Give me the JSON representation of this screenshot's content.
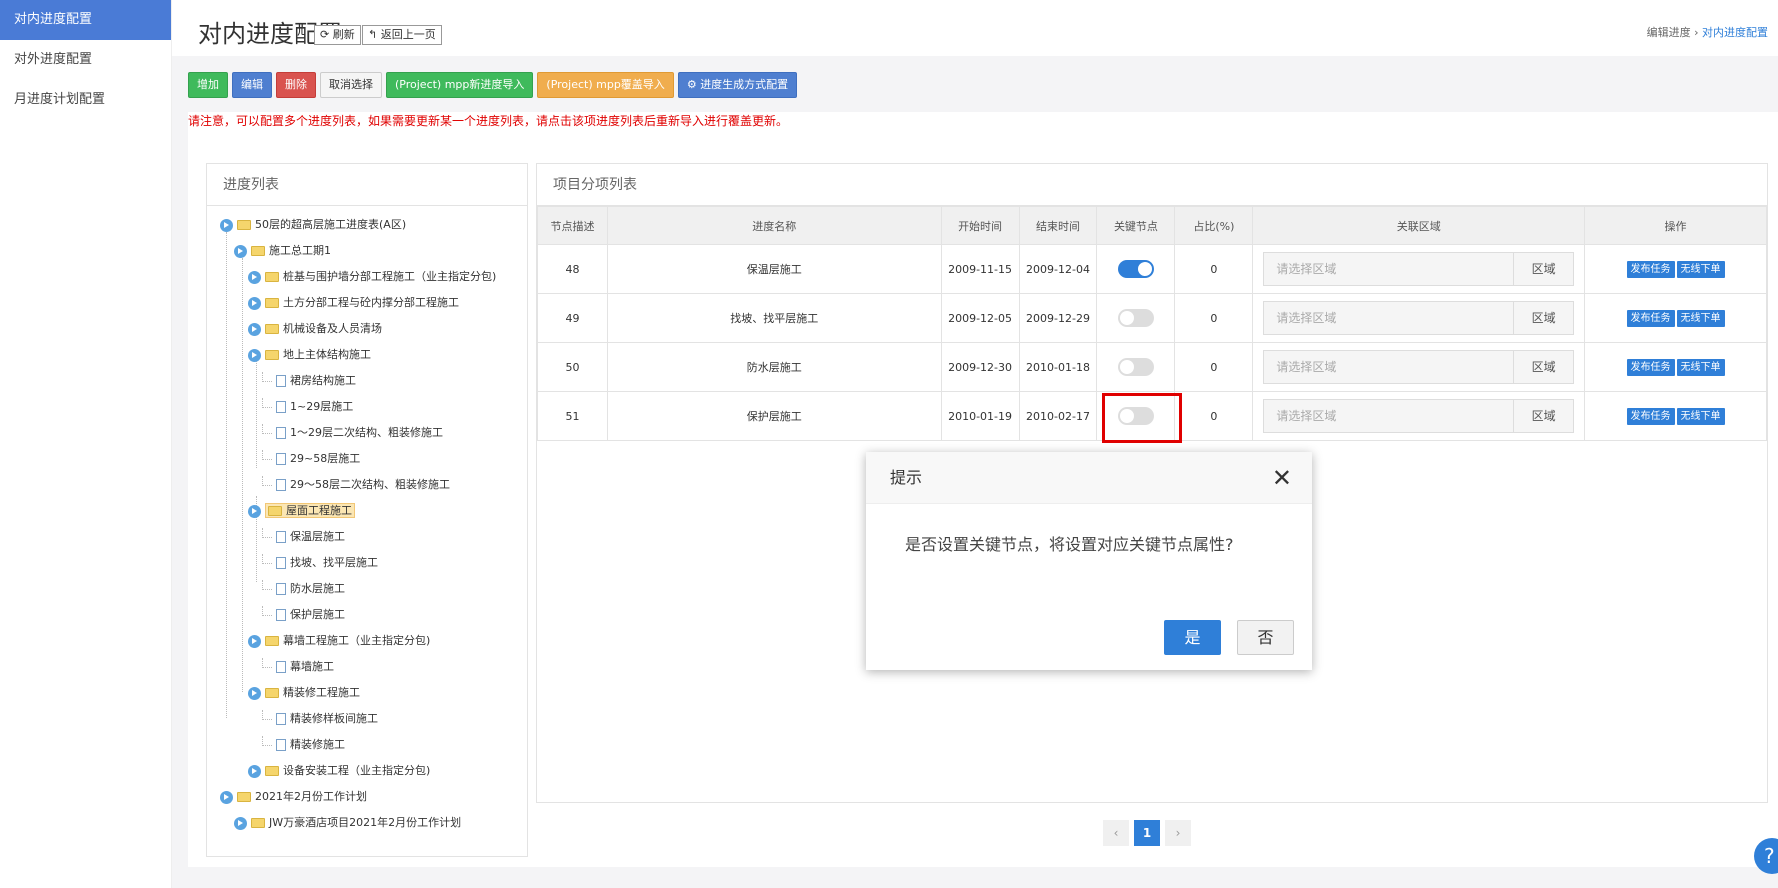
{
  "sidebar": {
    "items": [
      {
        "label": "对内进度配置"
      },
      {
        "label": "对外进度配置"
      },
      {
        "label": "月进度计划配置"
      }
    ]
  },
  "header": {
    "title": "对内进度配置",
    "refresh": "刷新",
    "back": "返回上一页",
    "breadcrumb_parent": "编辑进度",
    "breadcrumb_current": "对内进度配置"
  },
  "toolbar": {
    "add": "增加",
    "edit": "编辑",
    "delete": "删除",
    "cancel": "取消选择",
    "import_new": "(Project) mpp新进度导入",
    "import_cover": "(Project) mpp覆盖导入",
    "config": "进度生成方式配置"
  },
  "notice": "请注意，可以配置多个进度列表，如果需要更新某一个进度列表，请点击该项进度列表后重新导入进行覆盖更新。",
  "tree_panel": {
    "title": "进度列表",
    "nodes": [
      {
        "label": "50层的超高层施工进度表(A区)"
      },
      {
        "label": "施工总工期1"
      },
      {
        "label": "桩基与围护墙分部工程施工（业主指定分包)"
      },
      {
        "label": "土方分部工程与砼内撑分部工程施工"
      },
      {
        "label": "机械设备及人员清场"
      },
      {
        "label": "地上主体结构施工"
      },
      {
        "label": "裙房结构施工"
      },
      {
        "label": "1~29层施工"
      },
      {
        "label": "1～29层二次结构、粗装修施工"
      },
      {
        "label": "29~58层施工"
      },
      {
        "label": "29～58层二次结构、粗装修施工"
      },
      {
        "label": "屋面工程施工"
      },
      {
        "label": "保温层施工"
      },
      {
        "label": "找坡、找平层施工"
      },
      {
        "label": "防水层施工"
      },
      {
        "label": "保护层施工"
      },
      {
        "label": "幕墙工程施工（业主指定分包)"
      },
      {
        "label": "幕墙施工"
      },
      {
        "label": "精装修工程施工"
      },
      {
        "label": "精装修样板间施工"
      },
      {
        "label": "精装修施工"
      },
      {
        "label": "设备安装工程（业主指定分包)"
      },
      {
        "label": "2021年2月份工作计划"
      },
      {
        "label": "JW万豪酒店项目2021年2月份工作计划"
      }
    ]
  },
  "table_panel": {
    "title": "项目分项列表",
    "columns": [
      "节点描述",
      "进度名称",
      "开始时间",
      "结束时间",
      "关键节点",
      "占比(%)",
      "关联区域",
      "操作"
    ],
    "rows": [
      {
        "id": "48",
        "name": "保温层施工",
        "start": "2009-11-15",
        "end": "2009-12-04",
        "key_node": true,
        "ratio": "0"
      },
      {
        "id": "49",
        "name": "找坡、找平层施工",
        "start": "2009-12-05",
        "end": "2009-12-29",
        "key_node": false,
        "ratio": "0"
      },
      {
        "id": "50",
        "name": "防水层施工",
        "start": "2009-12-30",
        "end": "2010-01-18",
        "key_node": false,
        "ratio": "0"
      },
      {
        "id": "51",
        "name": "保护层施工",
        "start": "2010-01-19",
        "end": "2010-02-17",
        "key_node": false,
        "ratio": "0"
      }
    ],
    "region_placeholder": "请选择区域",
    "region_button": "区域",
    "publish": "发布任务",
    "no_order": "无线下单"
  },
  "pager": {
    "prev": "‹",
    "current": "1",
    "next": "›"
  },
  "dialog": {
    "title": "提示",
    "message": "是否设置关键节点，将设置对应关键节点属性?",
    "yes": "是",
    "no": "否",
    "close": "✕"
  },
  "help": "?"
}
